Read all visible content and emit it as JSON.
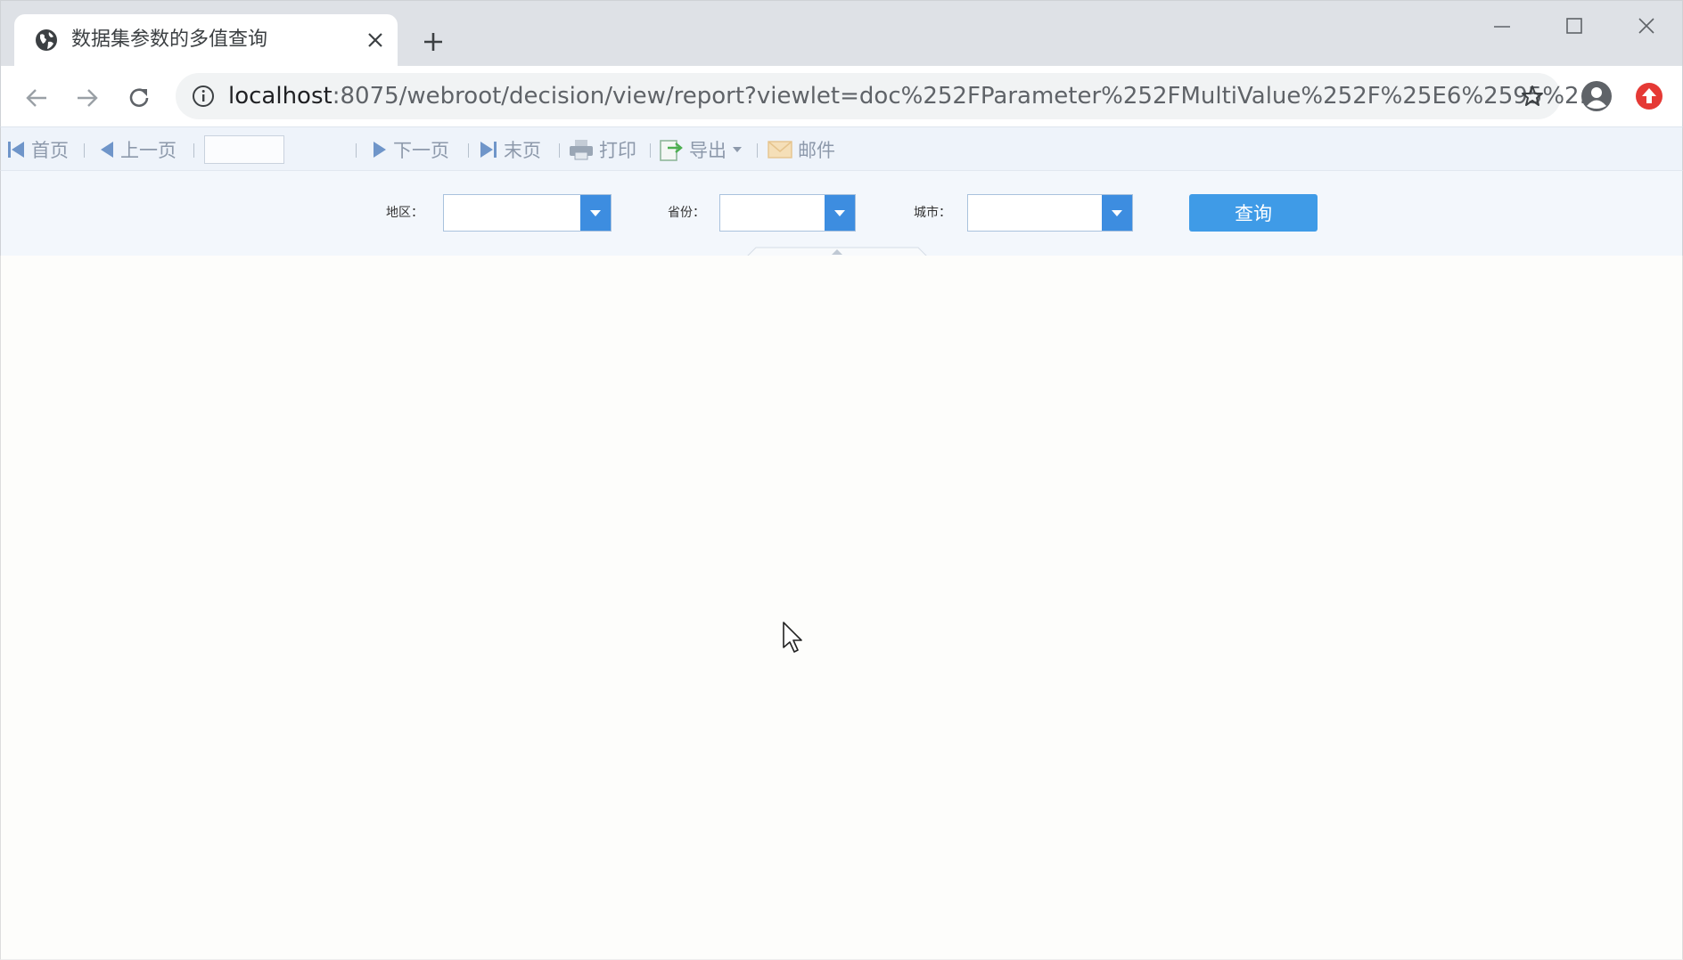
{
  "browser": {
    "tab": {
      "title": "数据集参数的多值查询",
      "icon": "globe-icon",
      "close_icon": "close-icon"
    },
    "new_tab_icon": "plus-icon",
    "window_controls": [
      "minimize-icon",
      "maximize-icon",
      "close-icon"
    ],
    "address": {
      "host": "localhost",
      "path": ":8075/webroot/decision/view/report?viewlet=doc%252FParameter%252FMultiValue%252F%25E6%2595%2..."
    },
    "colors": {
      "tab_strip": "#dee1e6",
      "omnibox": "#f1f3f4",
      "extension": "#e53935"
    }
  },
  "toolbar": {
    "first_label": "首页",
    "prev_label": "上一页",
    "page_value": "",
    "next_label": "下一页",
    "last_label": "末页",
    "print_label": "打印",
    "export_label": "导出",
    "mail_label": "邮件"
  },
  "params": {
    "region_label": "地区：",
    "region_value": "",
    "province_label": "省份：",
    "province_value": "",
    "city_label": "城市：",
    "city_value": "",
    "query_label": "查询",
    "colors": {
      "trigger": "#3d8de0",
      "button": "#3f9be7",
      "panel": "#f3f7fc"
    }
  }
}
